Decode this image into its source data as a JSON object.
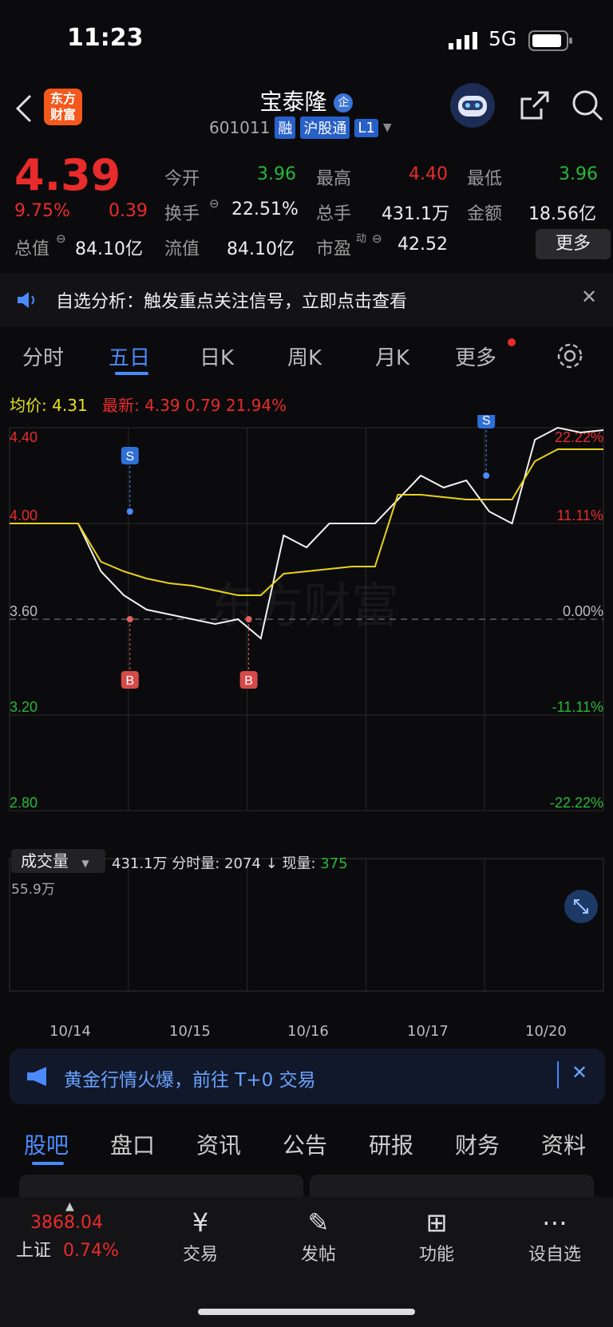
{
  "status_bar": {
    "time": "11:23",
    "network": "5G"
  },
  "header": {
    "title": "宝泰隆",
    "title_badge": "企",
    "code": "601011",
    "tags": [
      "融",
      "沪股通",
      "L1"
    ],
    "logo_text_1": "东方",
    "logo_text_2": "财富"
  },
  "quote": {
    "price": "4.39",
    "change_pct": "9.75%",
    "change": "0.39",
    "open_label": "今开",
    "open": "3.96",
    "high_label": "最高",
    "high": "4.40",
    "low_label": "最低",
    "low": "3.96",
    "turnover_label": "换手",
    "turnover": "22.51%",
    "volume_label": "总手",
    "volume": "431.1万",
    "amount_label": "金额",
    "amount": "18.56亿",
    "mcap_label": "总值",
    "mcap": "84.10亿",
    "float_label": "流值",
    "float_cap": "84.10亿",
    "pe_label": "市盈",
    "pe_sup": "动",
    "pe": "42.52",
    "more_label": "更多"
  },
  "notice": {
    "text": "自选分析：触发重点关注信号，立即点击查看"
  },
  "tabs": {
    "items": [
      "分时",
      "五日",
      "日K",
      "周K",
      "月K",
      "更多"
    ],
    "active": "五日"
  },
  "chart_info": {
    "avg_label": "均价:",
    "avg": "4.31",
    "latest_label": "最新:",
    "latest": "4.39",
    "latest_change": "0.79",
    "latest_pct": "21.94%"
  },
  "chart_data": {
    "type": "line",
    "title": "",
    "x_ticks": [
      "10/14",
      "10/15",
      "10/16",
      "10/17",
      "10/20"
    ],
    "y_ticks_left": [
      "4.40",
      "4.00",
      "3.60",
      "3.20",
      "2.80"
    ],
    "y_ticks_right": [
      "22.22%",
      "11.11%",
      "0.00%",
      "-11.11%",
      "-22.22%"
    ],
    "ylim": [
      2.8,
      4.4
    ],
    "baseline": 3.6,
    "series": [],
    "price_values": [
      4.0,
      4.0,
      4.0,
      4.0,
      3.8,
      3.7,
      3.64,
      3.62,
      3.6,
      3.58,
      3.6,
      3.52,
      3.95,
      3.9,
      4.0,
      4.0,
      4.0,
      4.1,
      4.2,
      4.15,
      4.18,
      4.05,
      4.0,
      4.35,
      4.4,
      4.38,
      4.39
    ],
    "avg_values": [
      4.0,
      4.0,
      4.0,
      4.0,
      3.84,
      3.8,
      3.77,
      3.75,
      3.74,
      3.72,
      3.7,
      3.7,
      3.79,
      3.8,
      3.81,
      3.82,
      3.82,
      4.12,
      4.12,
      4.11,
      4.1,
      4.1,
      4.1,
      4.26,
      4.31,
      4.31,
      4.31
    ],
    "markers": [
      {
        "label": "S",
        "day_index": 1,
        "price": 4.05
      },
      {
        "label": "B",
        "day_index": 1,
        "price": 3.6
      },
      {
        "label": "B",
        "day_index": 2,
        "price": 3.6
      },
      {
        "label": "S",
        "day_index": 4,
        "price": 4.2
      }
    ],
    "grid": true
  },
  "volume_panel": {
    "selector_label": "成交量",
    "total": "431.1万",
    "tick_label": "分时量:",
    "tick_value": "2074",
    "tick_arrow": "↓",
    "current_label": "现量:",
    "current_value": "375",
    "max_label": "55.9万"
  },
  "ad_banner": {
    "text": "黄金行情火爆，前往 T+0 交易"
  },
  "sub_tabs": {
    "items": [
      "股吧",
      "盘口",
      "资讯",
      "公告",
      "研报",
      "财务",
      "资料"
    ]
  },
  "bottom_bar": {
    "index_value": "3868.04",
    "index_name": "上证",
    "index_pct": "0.74%",
    "items": [
      "交易",
      "发帖",
      "功能",
      "设自选"
    ]
  }
}
